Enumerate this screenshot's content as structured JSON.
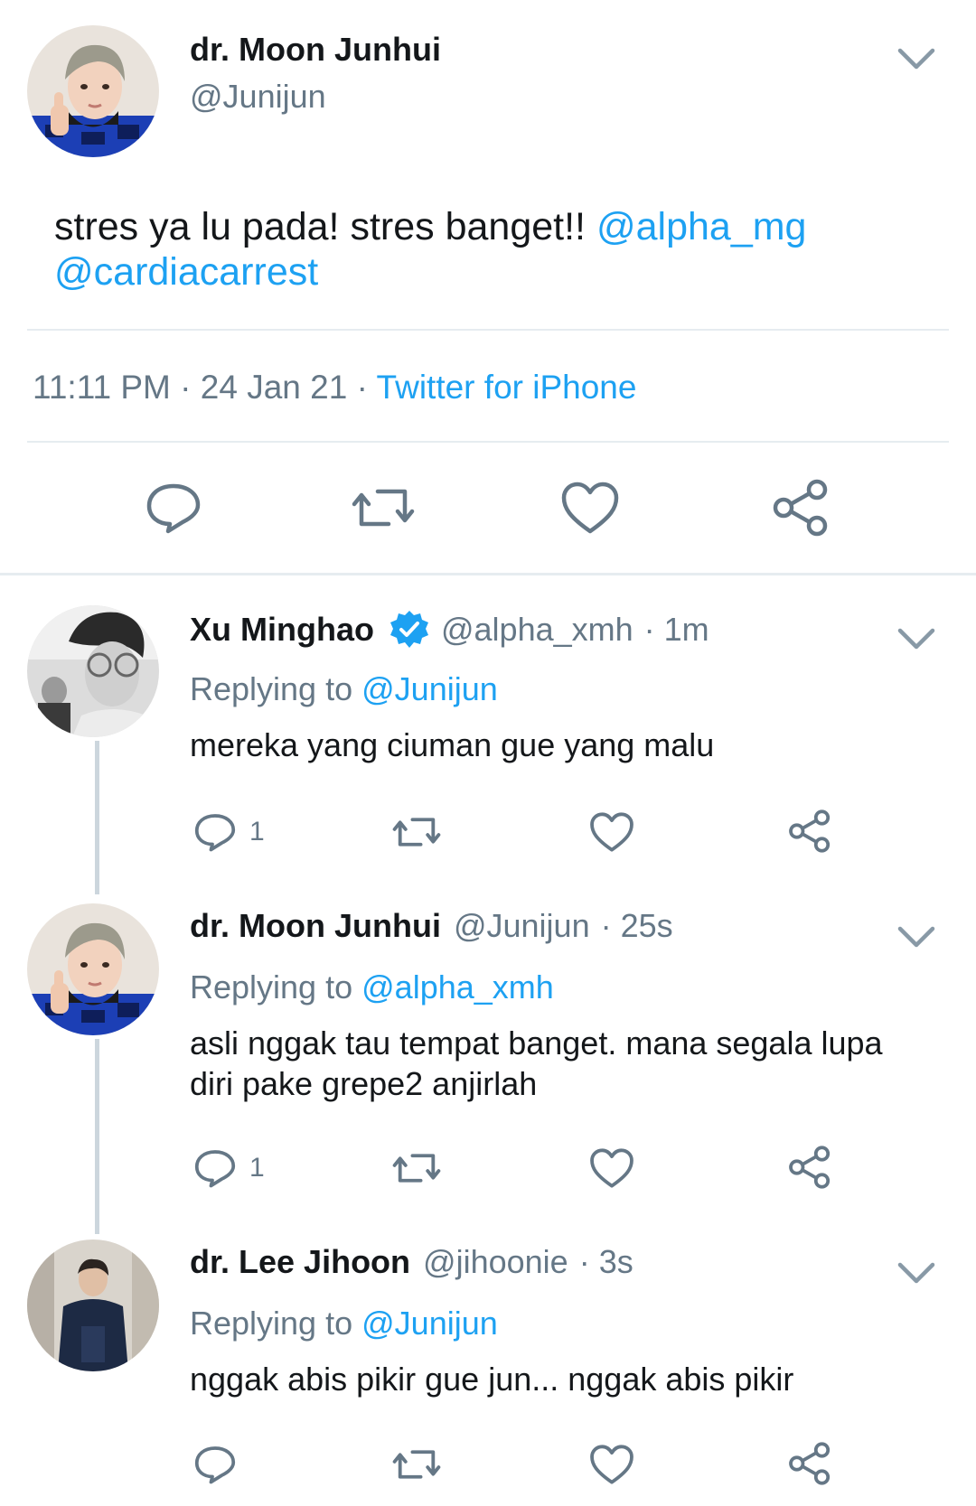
{
  "main_tweet": {
    "display_name": "dr. Moon Junhui",
    "handle": "@Junijun",
    "text": "stres ya lu pada! stres banget!!",
    "mention_1": "@alpha_mg",
    "mention_2": "@cardiacarrest",
    "time": "11:11 PM",
    "sep_1": "·",
    "date": "24 Jan 21",
    "sep_2": "·",
    "source": "Twitter for iPhone"
  },
  "replies": [
    {
      "display_name": "Xu Minghao",
      "verified": true,
      "handle": "@alpha_xmh",
      "time": "· 1m",
      "replying_prefix": "Replying to",
      "replying_to": "@Junijun",
      "text": "mereka yang ciuman gue yang malu",
      "reply_count": "1"
    },
    {
      "display_name": "dr. Moon Junhui",
      "verified": false,
      "handle": "@Junijun",
      "time": "· 25s",
      "replying_prefix": "Replying to",
      "replying_to": "@alpha_xmh",
      "text": "asli nggak tau tempat banget. mana segala lupa diri pake grepe2 anjirlah",
      "reply_count": "1"
    },
    {
      "display_name": "dr. Lee Jihoon",
      "verified": false,
      "handle": "@jihoonie",
      "time": "· 3s",
      "replying_prefix": "Replying to",
      "replying_to": "@Junijun",
      "text": "nggak abis pikir gue jun... nggak abis pikir",
      "reply_count": ""
    }
  ],
  "icons": {
    "reply": "reply-icon",
    "retweet": "retweet-icon",
    "like": "heart-icon",
    "share": "share-icon",
    "more": "chevron-down-icon",
    "verified": "verified-badge-icon"
  },
  "colors": {
    "link": "#1da1f2",
    "muted": "#657786",
    "text": "#14171a",
    "divider": "#e6ecf0"
  }
}
